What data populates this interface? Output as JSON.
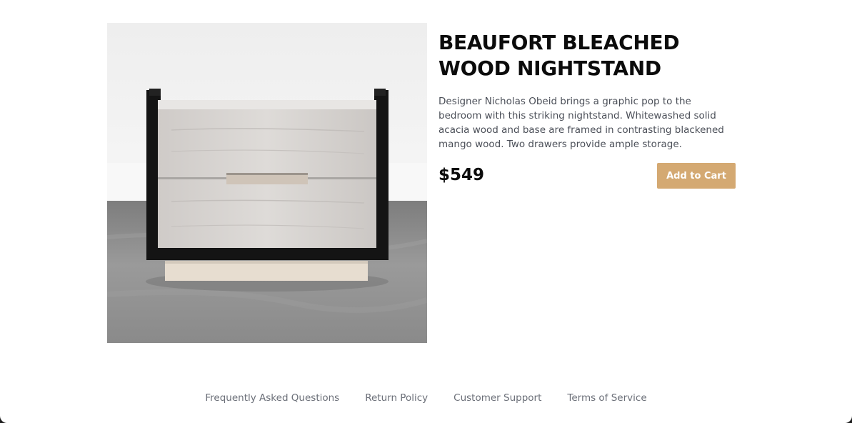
{
  "product": {
    "image": {
      "subject": "nightstand-photo",
      "colors": {
        "wall": "#f1f1f1",
        "floor": "#8f8f8f",
        "frame": "#121212",
        "wood": "#d6d3d0",
        "base": "#e6dccf"
      }
    },
    "title": "BEAUFORT BLEACHED\nWOOD NIGHTSTAND",
    "description": "Designer Nicholas Obeid brings a graphic pop to the bedroom with this striking nightstand. Whitewashed solid acacia wood and base are framed in contrasting blackened mango wood. Two drawers provide ample storage.",
    "price": "$549",
    "add_to_cart_label": "Add to Cart",
    "accent_color": "#d4a972"
  },
  "footer": {
    "links": [
      {
        "label": "Frequently Asked Questions"
      },
      {
        "label": "Return Policy"
      },
      {
        "label": "Customer Support"
      },
      {
        "label": "Terms of Service"
      }
    ]
  }
}
